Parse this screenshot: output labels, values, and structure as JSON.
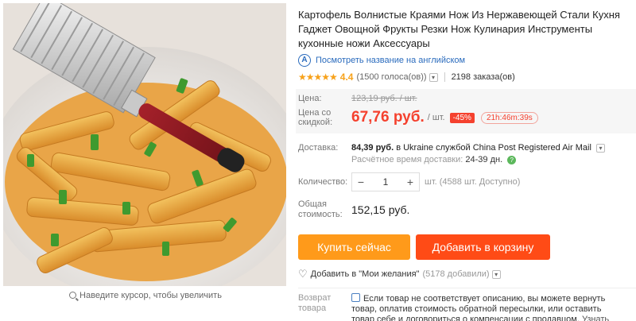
{
  "gallery": {
    "zoom_hint": "Наведите курсор, чтобы увеличить"
  },
  "product": {
    "title": "Картофель Волнистые Краями Нож Из Нержавеющей Стали Кухня Гаджет Овощной Фрукты Резки Нож Кулинария Инструменты кухонные ножи Аксессуары",
    "translate_link": "Посмотреть название на английском",
    "rating": {
      "value": "4.4",
      "stars": 4.4,
      "votes": "(1500 голоса(ов))",
      "orders": "2198 заказа(ов)"
    }
  },
  "price": {
    "old_label": "Цена:",
    "old_price": "123,19 руб. / шт.",
    "new_label_1": "Цена со",
    "new_label_2": "скидкой:",
    "new_price": "67,76 руб.",
    "unit": "/ шт.",
    "discount": "-45%",
    "timer": "21h:46m:39s"
  },
  "shipping": {
    "label": "Доставка:",
    "cost": "84,39 руб.",
    "destination": "в Ukraine службой China Post Registered Air Mail",
    "eta_label": "Расчётное время доставки:",
    "eta_days": "24-39",
    "eta_unit": "дн."
  },
  "quantity": {
    "label": "Количество:",
    "value": "1",
    "minus": "−",
    "plus": "+",
    "note": "шт. (4588 шт. Доступно)"
  },
  "total": {
    "label_1": "Общая",
    "label_2": "стоимость:",
    "value": "152,15 руб."
  },
  "actions": {
    "buy_now": "Купить сейчас",
    "add_to_cart": "Добавить в корзину",
    "wishlist": "Добавить в \"Мои желания\"",
    "wishlist_count": "(5178 добавили)"
  },
  "return_policy": {
    "label_1": "Возврат",
    "label_2": "товара",
    "text": "Если товар не соответствует описанию, вы можете вернуть товар, оплатив стоимость обратной пересылки, или оставить товар себе и договориться о компенсации с продавцом.",
    "more": "Узнать подробнее ▸"
  },
  "colors": {
    "price_red": "#f5412e",
    "buy_orange": "#ff9a1a",
    "cart_red": "#ff4b16",
    "star": "#f7a21b",
    "link_blue": "#2a6bbd"
  }
}
